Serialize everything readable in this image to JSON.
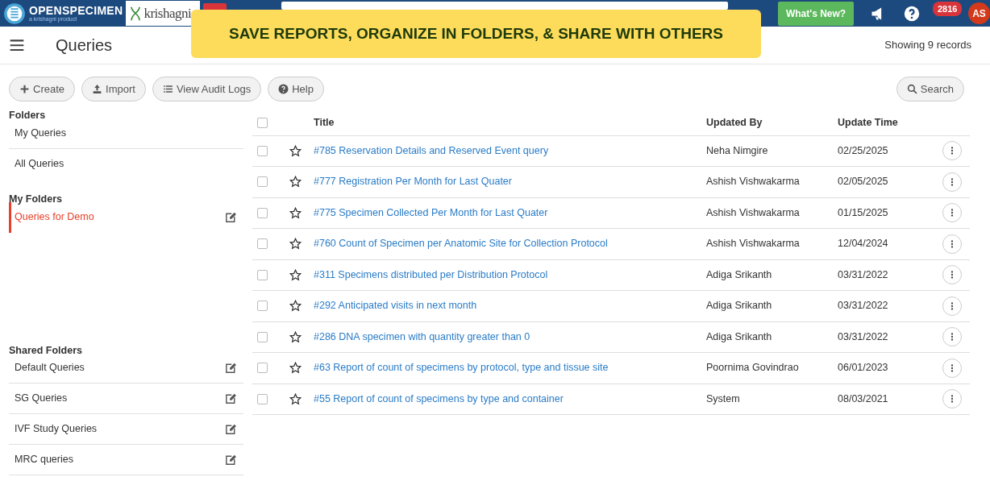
{
  "header": {
    "brand": "OPENSPECIMEN",
    "brand_tagline": "a krishagni product",
    "partner_logo": "krishagni",
    "whats_new": "What's New?",
    "notification_count": "2816",
    "avatar": "AS"
  },
  "banner": "SAVE REPORTS, ORGANIZE IN FOLDERS, & SHARE WITH OTHERS",
  "page": {
    "title": "Queries",
    "record_count": "Showing 9 records"
  },
  "toolbar": [
    {
      "label": "Create"
    },
    {
      "label": "Import"
    },
    {
      "label": "View Audit Logs"
    },
    {
      "label": "Help"
    }
  ],
  "search_button": "Search",
  "sidebar": [
    {
      "heading": "Folders",
      "items": [
        {
          "label": "My Queries",
          "selected": false,
          "editable": false
        },
        {
          "label": "All Queries",
          "selected": false,
          "editable": false
        }
      ]
    },
    {
      "heading": "My Folders",
      "items": [
        {
          "label": "Queries for Demo",
          "selected": true,
          "editable": true
        }
      ]
    },
    {
      "heading": "Shared Folders",
      "items": [
        {
          "label": "Default Queries",
          "selected": false,
          "editable": true
        },
        {
          "label": "SG Queries",
          "selected": false,
          "editable": true
        },
        {
          "label": "IVF Study Queries",
          "selected": false,
          "editable": true
        },
        {
          "label": "MRC queries",
          "selected": false,
          "editable": true
        }
      ]
    }
  ],
  "table": {
    "all_checked": false,
    "columns": [
      "Title",
      "Updated By",
      "Update Time"
    ],
    "rows": [
      {
        "title": "#785 Reservation Details and Reserved Event query",
        "updated_by": "Neha Nimgire",
        "update_time": "02/25/2025",
        "checked": false,
        "starred": false
      },
      {
        "title": "#777 Registration Per Month for Last Quater",
        "updated_by": "Ashish Vishwakarma",
        "update_time": "02/05/2025",
        "checked": false,
        "starred": false
      },
      {
        "title": "#775 Specimen Collected Per Month for Last Quater",
        "updated_by": "Ashish Vishwakarma",
        "update_time": "01/15/2025",
        "checked": false,
        "starred": false
      },
      {
        "title": "#760 Count of Specimen per Anatomic Site for Collection Protocol",
        "updated_by": "Ashish Vishwakarma",
        "update_time": "12/04/2024",
        "checked": false,
        "starred": false
      },
      {
        "title": "#311 Specimens distributed per Distribution Protocol",
        "updated_by": "Adiga Srikanth",
        "update_time": "03/31/2022",
        "checked": false,
        "starred": false
      },
      {
        "title": "#292 Anticipated visits in next month",
        "updated_by": "Adiga Srikanth",
        "update_time": "03/31/2022",
        "checked": false,
        "starred": false
      },
      {
        "title": "#286 DNA specimen with quantity greater than 0",
        "updated_by": "Adiga Srikanth",
        "update_time": "03/31/2022",
        "checked": false,
        "starred": false
      },
      {
        "title": "#63 Report of count of specimens by protocol, type and tissue site",
        "updated_by": "Poornima Govindrao",
        "update_time": "06/01/2023",
        "checked": false,
        "starred": false
      },
      {
        "title": "#55 Report of count of specimens by type and container",
        "updated_by": "System",
        "update_time": "08/03/2021",
        "checked": false,
        "starred": false
      }
    ]
  }
}
